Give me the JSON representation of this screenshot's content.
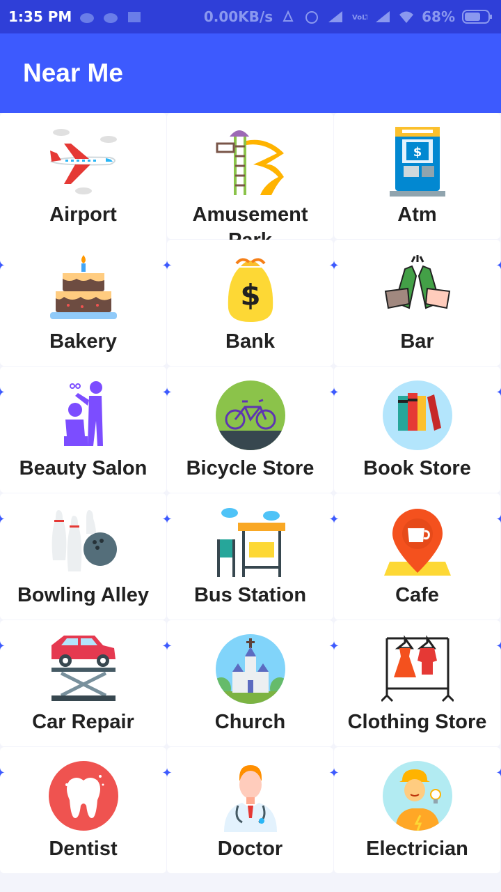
{
  "status_bar": {
    "time": "1:35 PM",
    "network_speed": "0.00KB/s",
    "battery": "68%",
    "icons": [
      "android-icon",
      "android-icon",
      "notification-icon",
      "mute-icon",
      "alarm-icon",
      "signal-icon",
      "volte-icon",
      "signal-icon",
      "wifi-icon",
      "battery-charging-icon"
    ]
  },
  "toolbar": {
    "title": "Near Me"
  },
  "places": [
    {
      "label": "Airport",
      "icon": "airplane-icon"
    },
    {
      "label": "Amusement Park",
      "icon": "slide-icon"
    },
    {
      "label": "Atm",
      "icon": "atm-icon"
    },
    {
      "label": "Bakery",
      "icon": "cake-icon"
    },
    {
      "label": "Bank",
      "icon": "money-bag-icon"
    },
    {
      "label": "Bar",
      "icon": "beer-toast-icon"
    },
    {
      "label": "Beauty Salon",
      "icon": "hairdresser-icon"
    },
    {
      "label": "Bicycle Store",
      "icon": "bicycle-icon"
    },
    {
      "label": "Book Store",
      "icon": "books-icon"
    },
    {
      "label": "Bowling Alley",
      "icon": "bowling-icon"
    },
    {
      "label": "Bus Station",
      "icon": "bus-stop-icon"
    },
    {
      "label": "Cafe",
      "icon": "coffee-pin-icon"
    },
    {
      "label": "Car Repair",
      "icon": "car-lift-icon"
    },
    {
      "label": "Church",
      "icon": "church-icon"
    },
    {
      "label": "Clothing Store",
      "icon": "clothes-rack-icon"
    },
    {
      "label": "Dentist",
      "icon": "tooth-icon"
    },
    {
      "label": "Doctor",
      "icon": "doctor-icon"
    },
    {
      "label": "Electrician",
      "icon": "electrician-icon"
    }
  ],
  "colors": {
    "status_bar": "#2f3fd8",
    "toolbar": "#3d5afe",
    "sparkle": "#3d5afe"
  }
}
